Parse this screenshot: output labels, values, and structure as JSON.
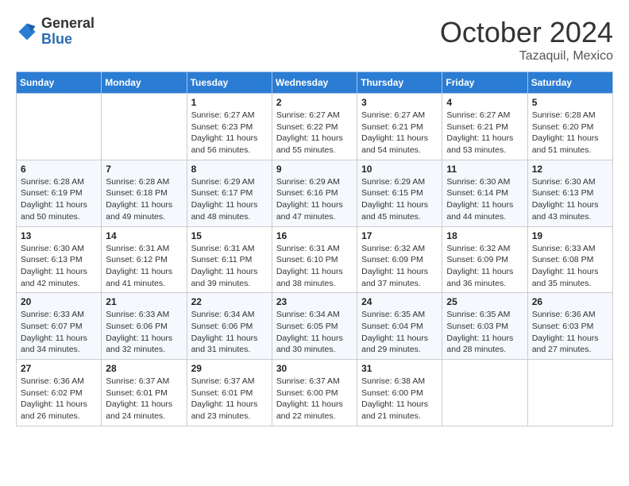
{
  "header": {
    "logo": {
      "line1": "General",
      "line2": "Blue"
    },
    "title": "October 2024",
    "location": "Tazaquil, Mexico"
  },
  "days_of_week": [
    "Sunday",
    "Monday",
    "Tuesday",
    "Wednesday",
    "Thursday",
    "Friday",
    "Saturday"
  ],
  "weeks": [
    [
      {
        "day": "",
        "info": ""
      },
      {
        "day": "",
        "info": ""
      },
      {
        "day": "1",
        "info": "Sunrise: 6:27 AM\nSunset: 6:23 PM\nDaylight: 11 hours and 56 minutes."
      },
      {
        "day": "2",
        "info": "Sunrise: 6:27 AM\nSunset: 6:22 PM\nDaylight: 11 hours and 55 minutes."
      },
      {
        "day": "3",
        "info": "Sunrise: 6:27 AM\nSunset: 6:21 PM\nDaylight: 11 hours and 54 minutes."
      },
      {
        "day": "4",
        "info": "Sunrise: 6:27 AM\nSunset: 6:21 PM\nDaylight: 11 hours and 53 minutes."
      },
      {
        "day": "5",
        "info": "Sunrise: 6:28 AM\nSunset: 6:20 PM\nDaylight: 11 hours and 51 minutes."
      }
    ],
    [
      {
        "day": "6",
        "info": "Sunrise: 6:28 AM\nSunset: 6:19 PM\nDaylight: 11 hours and 50 minutes."
      },
      {
        "day": "7",
        "info": "Sunrise: 6:28 AM\nSunset: 6:18 PM\nDaylight: 11 hours and 49 minutes."
      },
      {
        "day": "8",
        "info": "Sunrise: 6:29 AM\nSunset: 6:17 PM\nDaylight: 11 hours and 48 minutes."
      },
      {
        "day": "9",
        "info": "Sunrise: 6:29 AM\nSunset: 6:16 PM\nDaylight: 11 hours and 47 minutes."
      },
      {
        "day": "10",
        "info": "Sunrise: 6:29 AM\nSunset: 6:15 PM\nDaylight: 11 hours and 45 minutes."
      },
      {
        "day": "11",
        "info": "Sunrise: 6:30 AM\nSunset: 6:14 PM\nDaylight: 11 hours and 44 minutes."
      },
      {
        "day": "12",
        "info": "Sunrise: 6:30 AM\nSunset: 6:13 PM\nDaylight: 11 hours and 43 minutes."
      }
    ],
    [
      {
        "day": "13",
        "info": "Sunrise: 6:30 AM\nSunset: 6:13 PM\nDaylight: 11 hours and 42 minutes."
      },
      {
        "day": "14",
        "info": "Sunrise: 6:31 AM\nSunset: 6:12 PM\nDaylight: 11 hours and 41 minutes."
      },
      {
        "day": "15",
        "info": "Sunrise: 6:31 AM\nSunset: 6:11 PM\nDaylight: 11 hours and 39 minutes."
      },
      {
        "day": "16",
        "info": "Sunrise: 6:31 AM\nSunset: 6:10 PM\nDaylight: 11 hours and 38 minutes."
      },
      {
        "day": "17",
        "info": "Sunrise: 6:32 AM\nSunset: 6:09 PM\nDaylight: 11 hours and 37 minutes."
      },
      {
        "day": "18",
        "info": "Sunrise: 6:32 AM\nSunset: 6:09 PM\nDaylight: 11 hours and 36 minutes."
      },
      {
        "day": "19",
        "info": "Sunrise: 6:33 AM\nSunset: 6:08 PM\nDaylight: 11 hours and 35 minutes."
      }
    ],
    [
      {
        "day": "20",
        "info": "Sunrise: 6:33 AM\nSunset: 6:07 PM\nDaylight: 11 hours and 34 minutes."
      },
      {
        "day": "21",
        "info": "Sunrise: 6:33 AM\nSunset: 6:06 PM\nDaylight: 11 hours and 32 minutes."
      },
      {
        "day": "22",
        "info": "Sunrise: 6:34 AM\nSunset: 6:06 PM\nDaylight: 11 hours and 31 minutes."
      },
      {
        "day": "23",
        "info": "Sunrise: 6:34 AM\nSunset: 6:05 PM\nDaylight: 11 hours and 30 minutes."
      },
      {
        "day": "24",
        "info": "Sunrise: 6:35 AM\nSunset: 6:04 PM\nDaylight: 11 hours and 29 minutes."
      },
      {
        "day": "25",
        "info": "Sunrise: 6:35 AM\nSunset: 6:03 PM\nDaylight: 11 hours and 28 minutes."
      },
      {
        "day": "26",
        "info": "Sunrise: 6:36 AM\nSunset: 6:03 PM\nDaylight: 11 hours and 27 minutes."
      }
    ],
    [
      {
        "day": "27",
        "info": "Sunrise: 6:36 AM\nSunset: 6:02 PM\nDaylight: 11 hours and 26 minutes."
      },
      {
        "day": "28",
        "info": "Sunrise: 6:37 AM\nSunset: 6:01 PM\nDaylight: 11 hours and 24 minutes."
      },
      {
        "day": "29",
        "info": "Sunrise: 6:37 AM\nSunset: 6:01 PM\nDaylight: 11 hours and 23 minutes."
      },
      {
        "day": "30",
        "info": "Sunrise: 6:37 AM\nSunset: 6:00 PM\nDaylight: 11 hours and 22 minutes."
      },
      {
        "day": "31",
        "info": "Sunrise: 6:38 AM\nSunset: 6:00 PM\nDaylight: 11 hours and 21 minutes."
      },
      {
        "day": "",
        "info": ""
      },
      {
        "day": "",
        "info": ""
      }
    ]
  ]
}
